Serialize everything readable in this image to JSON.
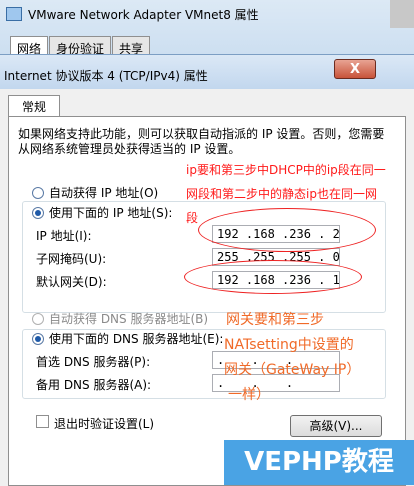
{
  "back_window": {
    "title": "VMware Network Adapter VMnet8 属性",
    "tabs": [
      "网络",
      "身份验证",
      "共享"
    ]
  },
  "front_window": {
    "title": "Internet 协议版本 4 (TCP/IPv4) 属性",
    "close_label": "X",
    "tab": "常规",
    "description": "如果网络支持此功能，则可以获取自动指派的 IP 设置。否则，您需要从网络系统管理员处获得适当的 IP 设置。",
    "ip_section": {
      "auto_label": "自动获得 IP 地址(O)",
      "manual_label": "使用下面的 IP 地址(S):",
      "ip_label": "IP 地址(I):",
      "ip_value": "192 .168 .236 . 2",
      "mask_label": "子网掩码(U):",
      "mask_value": "255 .255 .255 . 0",
      "gateway_label": "默认网关(D):",
      "gateway_value": "192 .168 .236 . 1"
    },
    "dns_section": {
      "auto_label": "自动获得 DNS 服务器地址(B)",
      "manual_label": "使用下面的 DNS 服务器地址(E):",
      "preferred_label": "首选 DNS 服务器(P):",
      "preferred_value": ". . .",
      "alternate_label": "备用 DNS 服务器(A):",
      "alternate_value": ". . ."
    },
    "validate_label": "退出时验证设置(L)",
    "advanced_label": "高级(V)..."
  },
  "annotations": {
    "note_red": [
      "ip要和第三步中DHCP中的ip段在同一",
      "网段和第二步中的静态ip也在同一网",
      "段"
    ],
    "note_orange": [
      "网关要和第三步",
      "NATsetting中设置的",
      "网关（GateWay IP）",
      "一样）"
    ]
  },
  "watermark": "VEPHP教程"
}
